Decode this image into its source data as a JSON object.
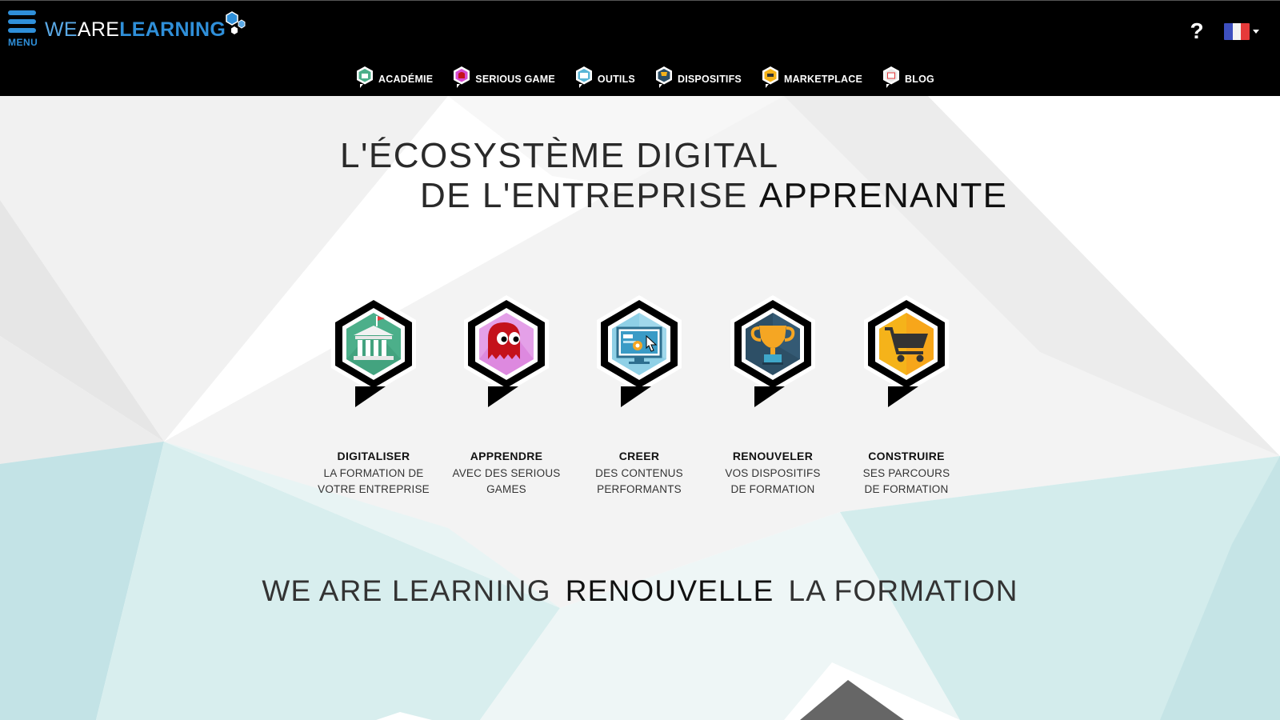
{
  "header": {
    "menu_label": "MENU",
    "logo": {
      "part1": "WE",
      "part2": "ARE",
      "part3": "LEARNING"
    },
    "help_label": "?",
    "language": {
      "icon": "france-flag-icon"
    }
  },
  "nav": {
    "items": [
      {
        "label": "ACADÉMIE",
        "icon": "academy-icon",
        "color": "#4caf8a"
      },
      {
        "label": "SERIOUS GAME",
        "icon": "ghost-icon",
        "color": "#d64bd1"
      },
      {
        "label": "OUTILS",
        "icon": "screen-icon",
        "color": "#5ab6d6"
      },
      {
        "label": "DISPOSITIFS",
        "icon": "trophy-icon",
        "color": "#2d4f66"
      },
      {
        "label": "MARKETPLACE",
        "icon": "cart-icon",
        "color": "#f5b31a"
      },
      {
        "label": "BLOG",
        "icon": "blog-icon",
        "color": "#e8e8e8"
      }
    ]
  },
  "hero": {
    "line1": "L'ÉCOSYSTÈME DIGITAL",
    "line2": "DE L'ENTREPRISE",
    "line2_emph": "APPRENANTE"
  },
  "features": [
    {
      "title": "DIGITALISER",
      "desc1": "LA FORMATION DE",
      "desc2": "VOTRE ENTREPRISE",
      "icon": "academy-building-icon",
      "color": "#4caf8a"
    },
    {
      "title": "APPRENDRE",
      "desc1": "AVEC DES SERIOUS",
      "desc2": "GAMES",
      "icon": "ghost-icon",
      "color": "#d64bd1"
    },
    {
      "title": "CREER",
      "desc1": "DES CONTENUS",
      "desc2": "PERFORMANTS",
      "icon": "computer-screen-icon",
      "color": "#5ab6d6"
    },
    {
      "title": "RENOUVELER",
      "desc1": "VOS DISPOSITIFS",
      "desc2": "DE FORMATION",
      "icon": "trophy-icon",
      "color": "#2d4f66"
    },
    {
      "title": "CONSTRUIRE",
      "desc1": "SES PARCOURS",
      "desc2": "DE FORMATION",
      "icon": "shopping-cart-icon",
      "color": "#f5b31a"
    }
  ],
  "tagline": {
    "part1": "WE ARE LEARNING",
    "part2": "RENOUVELLE",
    "part3": "LA FORMATION"
  },
  "colors": {
    "header_bg": "#000000",
    "brand_blue": "#2f8fd9",
    "background_teal": "#c6e6e8"
  }
}
